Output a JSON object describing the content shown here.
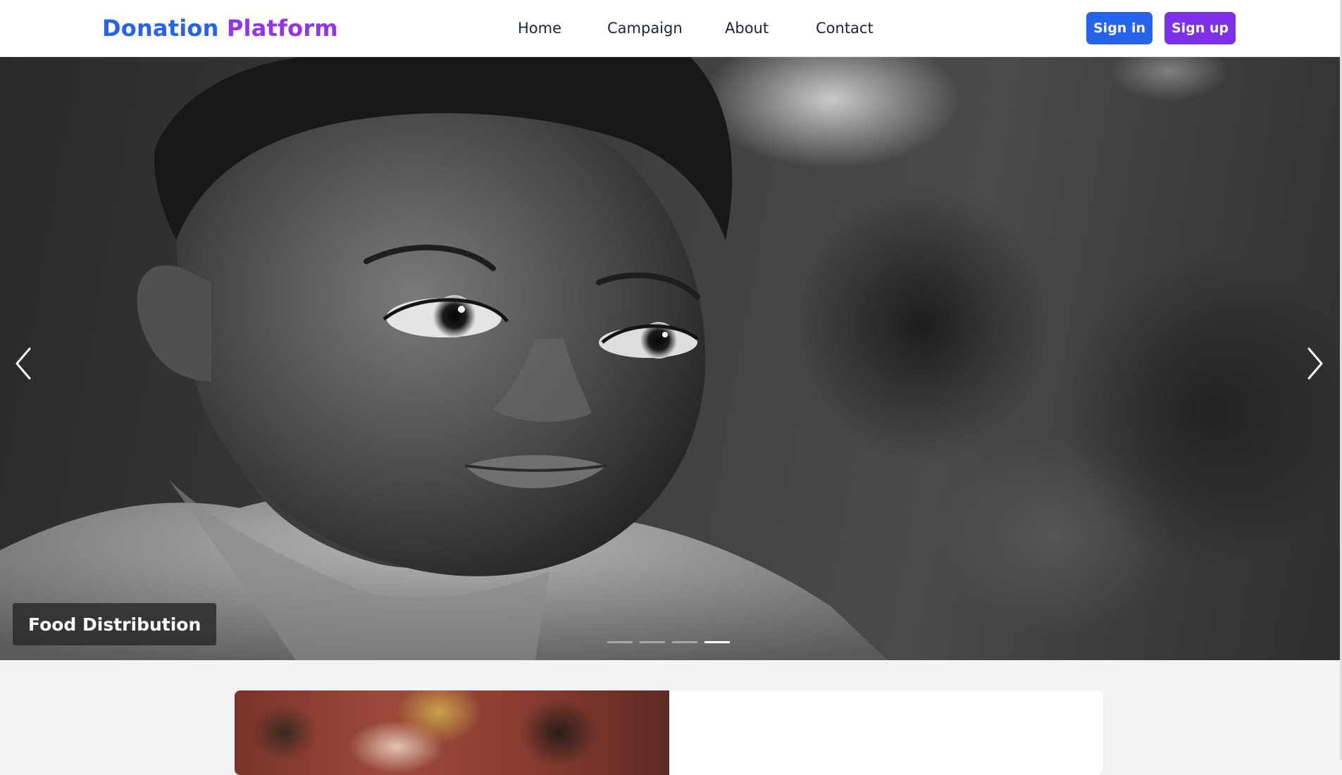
{
  "brand": {
    "word1": "Donation",
    "word2": "Platform"
  },
  "nav": {
    "items": [
      {
        "label": "Home"
      },
      {
        "label": "Campaign"
      },
      {
        "label": "About"
      },
      {
        "label": "Contact"
      }
    ],
    "signin_label": "Sign in",
    "signup_label": "Sign up"
  },
  "hero": {
    "caption": "Food Distribution",
    "slide_count": 4,
    "active_slide": 4,
    "prev_icon": "chevron-left-icon",
    "next_icon": "chevron-right-icon"
  },
  "colors": {
    "brand_blue": "#2563eb",
    "brand_purple": "#9333ea",
    "signup_purple": "#7e2fe8",
    "page_bg": "#f2f3f5"
  }
}
